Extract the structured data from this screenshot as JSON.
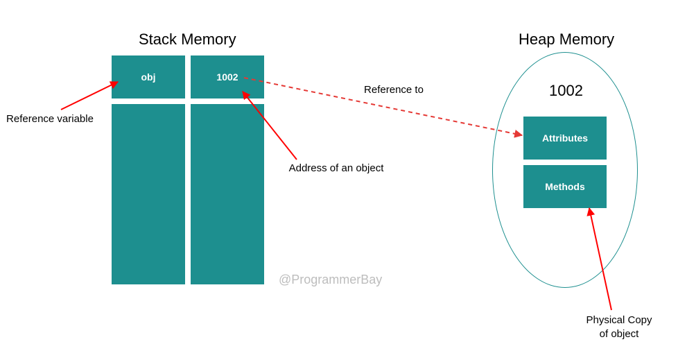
{
  "stack": {
    "title": "Stack Memory",
    "ref_var_name": "obj",
    "address_value": "1002"
  },
  "heap": {
    "title": "Heap Memory",
    "address_label": "1002",
    "attributes_label": "Attributes",
    "methods_label": "Methods"
  },
  "labels": {
    "reference_variable": "Reference variable",
    "address_of_object": "Address of an object",
    "reference_to": "Reference to",
    "physical_copy_line1": "Physical Copy",
    "physical_copy_line2": "of object"
  },
  "watermark": "@ProgrammerBay",
  "colors": {
    "teal": "#1d8f8f",
    "annotation_red": "#ff0000",
    "dashed_red": "#e53935"
  }
}
